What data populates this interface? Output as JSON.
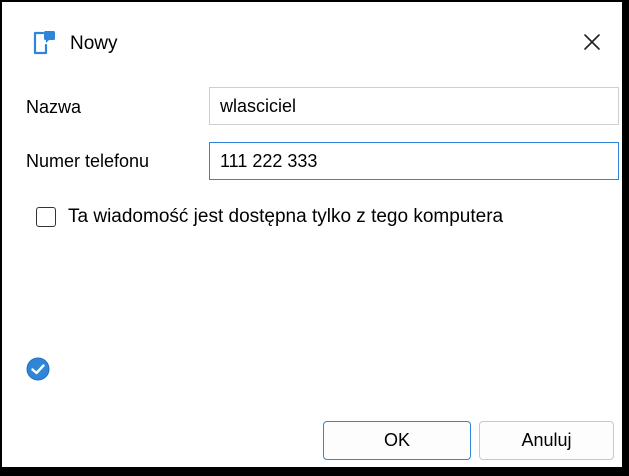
{
  "window": {
    "title": "Nowy",
    "app_icon": "phone-message-icon",
    "close_icon": "close-icon"
  },
  "form": {
    "name_label": "Nazwa",
    "name_value": "wlasciciel",
    "phone_label": "Numer telefonu",
    "phone_value": "111 222 333",
    "local_only_label": "Ta wiadomość jest dostępna tylko z tego komputera",
    "local_only_checked": false
  },
  "status": {
    "icon": "check-circle-icon",
    "color": "#2f86d8"
  },
  "buttons": {
    "ok_label": "OK",
    "cancel_label": "Anuluj"
  },
  "colors": {
    "accent": "#2f86d8",
    "frame": "#000000"
  }
}
